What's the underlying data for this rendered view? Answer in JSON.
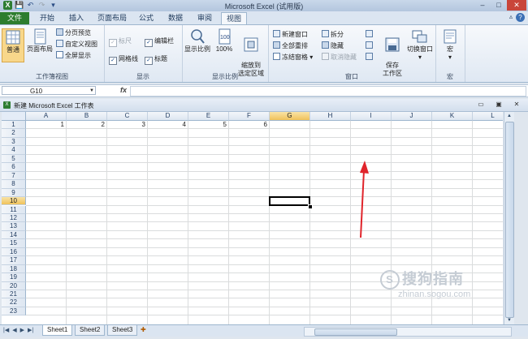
{
  "window": {
    "title": "Microsoft Excel (试用版)",
    "qat_icons": [
      "excel-logo-icon",
      "save-icon",
      "undo-icon",
      "redo-icon",
      "customize-icon"
    ],
    "controls": [
      "–",
      "□",
      "✕"
    ]
  },
  "ribbon_tabs": [
    {
      "label": "文件",
      "kind": "file"
    },
    {
      "label": "开始"
    },
    {
      "label": "插入"
    },
    {
      "label": "页面布局"
    },
    {
      "label": "公式"
    },
    {
      "label": "数据"
    },
    {
      "label": "审阅"
    },
    {
      "label": "视图",
      "active": true
    }
  ],
  "ribbon": {
    "workbook_views": {
      "label": "工作簿视图",
      "normal": "普通",
      "page_layout": "页面布局",
      "page_break": "分页预览",
      "custom": "自定义视图",
      "fullscreen": "全屏显示"
    },
    "show": {
      "label": "显示",
      "ruler": "标尺",
      "formula_bar": "编辑栏",
      "gridlines": "网格线",
      "headings": "标题"
    },
    "zoom": {
      "label": "显示比例",
      "zoom": "显示比例",
      "hundred": "100%",
      "zoom_selection": "缩放到\n选定区域"
    },
    "window": {
      "label": "窗口",
      "new_window": "新建窗口",
      "arrange_all": "全部重排",
      "freeze": "冻结窗格",
      "split": "拆分",
      "hide": "隐藏",
      "unhide": "取消隐藏",
      "save_workspace": "保存\n工作区",
      "switch": "切换窗口"
    },
    "macros": {
      "label": "宏",
      "macro": "宏"
    }
  },
  "formula_bar": {
    "name_box": "G10",
    "fx": "fx",
    "content": ""
  },
  "workbook": {
    "title": "新建 Microsoft Excel 工作表"
  },
  "sheet": {
    "columns": [
      "A",
      "B",
      "C",
      "D",
      "E",
      "F",
      "G",
      "H",
      "I",
      "J",
      "K",
      "L"
    ],
    "selected_column": "G",
    "rows": [
      "1",
      "2",
      "3",
      "4",
      "5",
      "6",
      "7",
      "8",
      "9",
      "10",
      "11",
      "12",
      "13",
      "14",
      "15",
      "16",
      "17",
      "18",
      "19",
      "20",
      "21",
      "22",
      "23"
    ],
    "selected_row": "10",
    "row1_values": [
      "1",
      "2",
      "3",
      "4",
      "5",
      "6"
    ],
    "active_cell": "G10"
  },
  "sheet_tabs": [
    "Sheet1",
    "Sheet2",
    "Sheet3"
  ],
  "watermark": {
    "text": "搜狗指南",
    "sub": "zhinan.sogou.com",
    "logo": "S"
  },
  "colors": {
    "file_tab": "#2d7d2e",
    "selection_header": "#f0c25a",
    "arrow": "#e0242b"
  }
}
